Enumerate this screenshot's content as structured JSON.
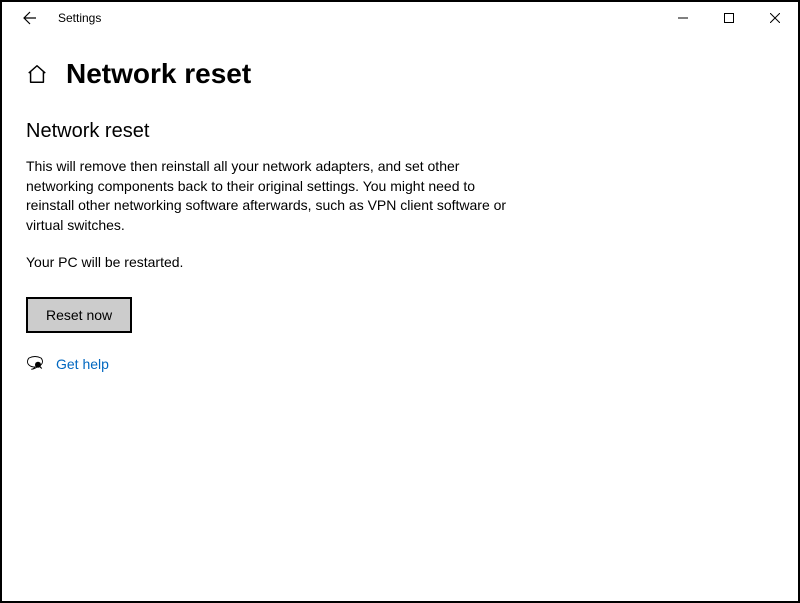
{
  "window": {
    "app_name": "Settings"
  },
  "header": {
    "title": "Network reset"
  },
  "content": {
    "heading": "Network reset",
    "description": "This will remove then reinstall all your network adapters, and set other networking components back to their original settings. You might need to reinstall other networking software afterwards, such as VPN client software or virtual switches.",
    "restart_note": "Your PC will be restarted.",
    "reset_button_label": "Reset now",
    "help_link_label": "Get help"
  }
}
